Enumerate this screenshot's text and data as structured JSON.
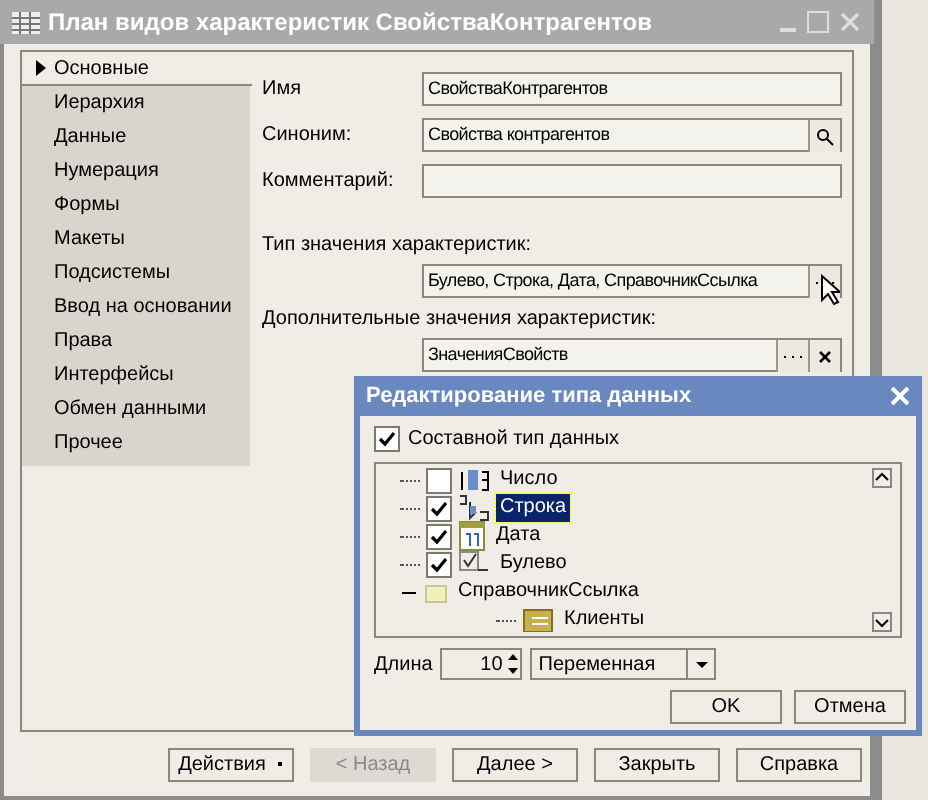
{
  "window": {
    "title": "План видов характеристик СвойстваКонтрагентов"
  },
  "sidebar": {
    "items": [
      {
        "label": "Основные",
        "selected": true
      },
      {
        "label": "Иерархия",
        "selected": false
      },
      {
        "label": "Данные",
        "selected": false
      },
      {
        "label": "Нумерация",
        "selected": false
      },
      {
        "label": "Формы",
        "selected": false
      },
      {
        "label": "Макеты",
        "selected": false
      },
      {
        "label": "Подсистемы",
        "selected": false
      },
      {
        "label": "Ввод на основании",
        "selected": false
      },
      {
        "label": "Права",
        "selected": false
      },
      {
        "label": "Интерфейсы",
        "selected": false
      },
      {
        "label": "Обмен данными",
        "selected": false
      },
      {
        "label": "Прочее",
        "selected": false
      }
    ]
  },
  "form": {
    "fields": [
      {
        "label": "Имя",
        "value": "СвойстваКонтрагентов",
        "kind": "plain"
      },
      {
        "label": "Синоним:",
        "value": "Свойства контрагентов",
        "kind": "lookup"
      },
      {
        "label": "Комментарий:",
        "kind": "plain"
      }
    ],
    "type_fields": [
      {
        "label": "Тип значения характеристик:",
        "value": "Булево, Строка, Дата, СправочникСсылка",
        "kind": "choice"
      },
      {
        "label": "Дополнительные значения характеристик:",
        "value": "ЗначенияСвойств",
        "kind": "choice_clear"
      }
    ]
  },
  "buttons": [
    {
      "label": "Действия",
      "kind": "menu",
      "disabled": false
    },
    {
      "label": "< Назад",
      "kind": "plain",
      "disabled": true
    },
    {
      "label": "Далее >",
      "kind": "plain",
      "disabled": false
    },
    {
      "label": "Закрыть",
      "kind": "plain",
      "disabled": false
    },
    {
      "label": "Справка",
      "kind": "plain",
      "disabled": false
    }
  ],
  "dialog": {
    "title": "Редактирование типа данных",
    "composite": {
      "label": "Составной тип данных",
      "checked": true
    },
    "types": [
      {
        "label": "Число",
        "kind": "number",
        "checked": false,
        "selected": false
      },
      {
        "label": "Строка",
        "kind": "string",
        "checked": true,
        "selected": true
      },
      {
        "label": "Дата",
        "kind": "date",
        "checked": true,
        "selected": false
      },
      {
        "label": "Булево",
        "kind": "boolean",
        "checked": true,
        "selected": false
      },
      {
        "label": "СправочникСсылка",
        "kind": "group",
        "expanded": true,
        "selected": false,
        "children": [
          {
            "label": "Клиенты",
            "kind": "catalog"
          }
        ]
      }
    ],
    "length": {
      "label": "Длина",
      "value": "10"
    },
    "mode": {
      "value": "Переменная"
    },
    "buttons": [
      "OK",
      "Отмена"
    ]
  }
}
